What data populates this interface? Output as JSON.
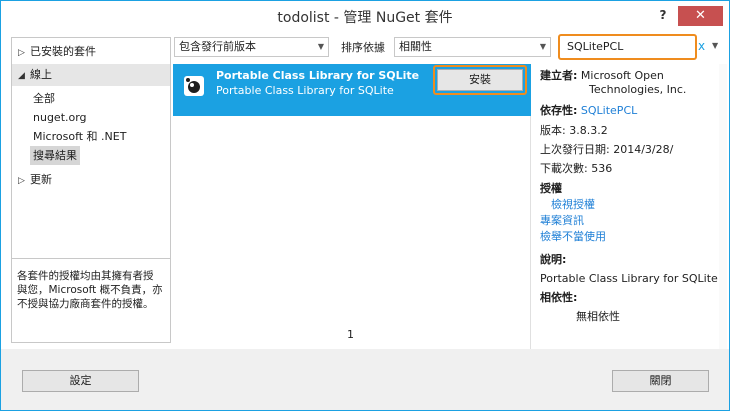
{
  "window": {
    "title": "todolist - 管理 NuGet 套件",
    "help": "?",
    "close": "✕"
  },
  "sidebar": {
    "installed": "已安裝的套件",
    "online": "線上",
    "online_items": [
      "全部",
      "nuget.org",
      "Microsoft 和 .NET",
      "搜尋結果"
    ],
    "updates": "更新",
    "disclaimer_lines": [
      "各套件的授權均由其擁有者授",
      "與您，Microsoft 概不負責，亦",
      "不授與協力廠商套件的授權。"
    ]
  },
  "toolbar": {
    "filter": "包含發行前版本",
    "sort_label": "排序依據",
    "sort_value": "相關性",
    "search_value": "SQLitePCL",
    "clear": "x"
  },
  "results": {
    "package_name": "Portable Class Library for SQLite",
    "package_desc": "Portable Class Library for SQLite",
    "install": "安裝",
    "page": "1"
  },
  "details": {
    "creator_label": "建立者:",
    "creator_line1": "Microsoft Open",
    "creator_line2": "Technologies, Inc.",
    "id_label": "依存性:",
    "id_value": "SQLitePCL",
    "version": "版本: 3.8.3.2",
    "last_published": "上次發行日期: 2014/3/28/",
    "downloads": "下載次數: 536",
    "license_label": "授權",
    "view_license": "檢視授權",
    "project_info": "專案資訊",
    "report_abuse": "檢舉不當使用",
    "description_label": "說明:",
    "description": "Portable Class Library for SQLite",
    "dependencies_label": "相依性:",
    "dependencies": "無相依性"
  },
  "footer": {
    "settings": "設定",
    "close": "關閉"
  }
}
